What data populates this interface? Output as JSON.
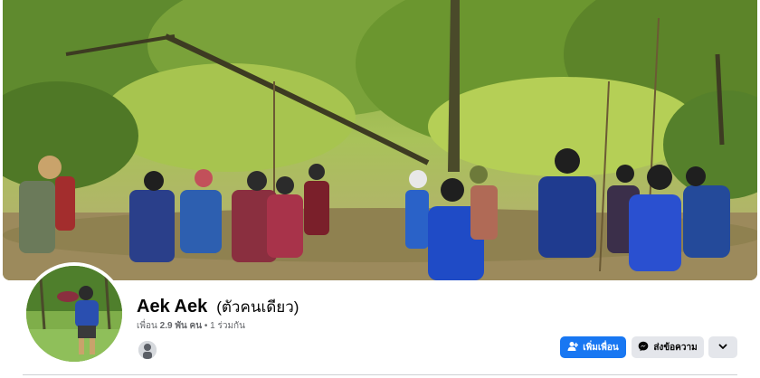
{
  "profile": {
    "name": "Aek Aek",
    "alternate_name": "(ตัวคนเดียว)",
    "friends_label": "เพื่อน",
    "friends_count": "2.9 พัน คน",
    "mutual_friends": "1 ร่วมกัน"
  },
  "actions": {
    "add_friend_label": "เพิ่มเพื่อน",
    "message_label": "ส่งข้อความ",
    "more_icon": "chevron-down-icon"
  },
  "colors": {
    "primary": "#1877f2",
    "secondary_button": "#e4e6eb",
    "muted_text": "#65676b"
  }
}
